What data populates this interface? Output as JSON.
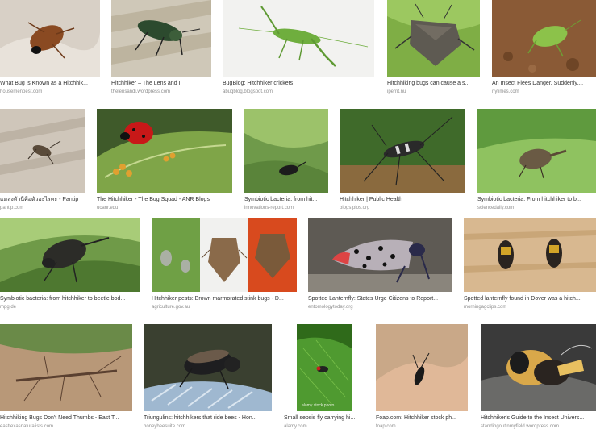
{
  "results": [
    {
      "caption": "What Bug is Known as a Hitchhik...",
      "source": "housemenpest.com",
      "subject": "bed-bug-image"
    },
    {
      "caption": "Hitchhiker – The Lens and I",
      "source": "thelensandi.wordpress.com",
      "subject": "beetle-on-wood-image"
    },
    {
      "caption": "BugBlog: Hitchhiker crickets",
      "source": "abugblog.blogspot.com",
      "subject": "green-cricket-image"
    },
    {
      "caption": "Hitchhiking bugs can cause a s...",
      "source": "ipernt.nu",
      "subject": "stink-bug-leaf-image"
    },
    {
      "caption": "An Insect Flees Danger. Suddenly,...",
      "source": "nytimes.com",
      "subject": "green-aphid-soil-image"
    },
    {
      "caption": "แมลงตัวนี้คือตัวอะไรคะ - Pantip",
      "source": "pantip.com",
      "subject": "small-insect-wood-image"
    },
    {
      "caption": "The Hitchhiker - The Bug Squad - ANR Blogs",
      "source": "ucanr.edu",
      "subject": "ladybug-leaf-image"
    },
    {
      "caption": "Symbiotic bacteria: from hit...",
      "source": "innovations-report.com",
      "subject": "weevil-green-image"
    },
    {
      "caption": "Hitchhiker | Public Health",
      "source": "blogs.plos.org",
      "subject": "mosquito-image"
    },
    {
      "caption": "Symbiotic bacteria: From hitchhiker to b...",
      "source": "sciencedaily.com",
      "subject": "weevil-leaf-image"
    },
    {
      "caption": "Symbiotic bacteria: from hitchhiker to beetle bod...",
      "source": "mpg.de",
      "subject": "beetle-leaf-closeup-image"
    },
    {
      "caption": "Hitchhiker pests: Brown marmorated stink bugs - D...",
      "source": "agriculture.gov.au",
      "subject": "stink-bug-collage-image"
    },
    {
      "caption": "Spotted Lanternfly: States Urge Citizens to Report...",
      "source": "entomologytoday.org",
      "subject": "spotted-lanternfly-image"
    },
    {
      "caption": "Spotted lanternfly found in Dover was a hitch...",
      "source": "morningagclips.com",
      "subject": "lanternfly-pair-image"
    },
    {
      "caption": "Hitchhiking Bugs Don't Need Thumbs - East T...",
      "source": "easttexasnaturalists.com",
      "subject": "walking-stick-image"
    },
    {
      "caption": "Triungulins: hitchhikers that ride bees - Hon...",
      "source": "honeybeesuite.com",
      "subject": "bee-triungulins-image"
    },
    {
      "caption": "Small sepsis fly carrying hi...",
      "source": "alamy.com",
      "subject": "sepsis-fly-image",
      "watermark": "alamy stock photo"
    },
    {
      "caption": "Foap.com: Hitchhiker stock ph...",
      "source": "foap.com",
      "subject": "insect-on-finger-image"
    },
    {
      "caption": "Hitchhiker's Guide to the Insect Univers...",
      "source": "standingoutinmyfield.wordpress.com",
      "subject": "bee-closeup-image"
    }
  ]
}
